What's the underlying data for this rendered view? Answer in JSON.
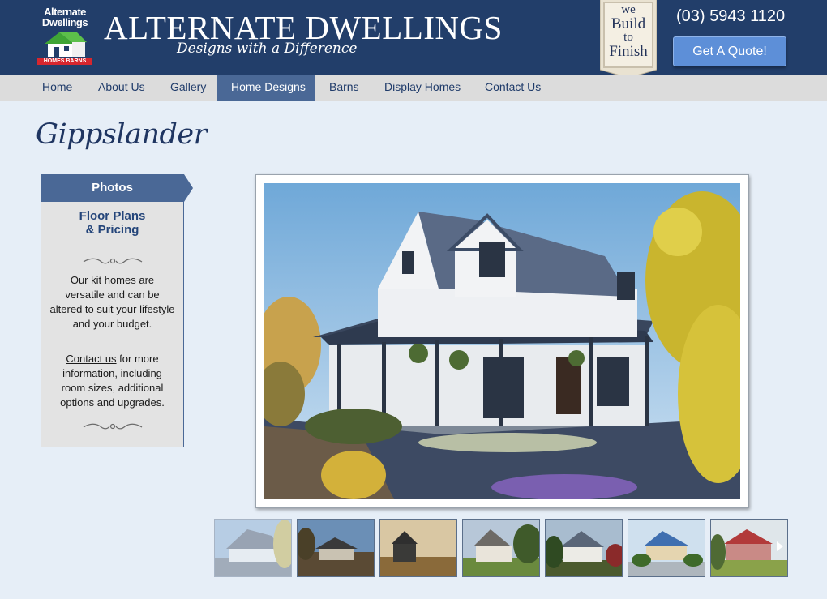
{
  "header": {
    "logo": {
      "line1": "Alternate",
      "line2": "Dwellings",
      "sub": "HOMES BARNS"
    },
    "brand_name": "ALTERNATE DWELLINGS",
    "tagline": "Designs with a Difference",
    "badge": {
      "line1": "we",
      "line2": "Build",
      "line3": "to",
      "line4": "Finish"
    },
    "phone": "(03) 5943 1120",
    "quote_button": "Get A Quote!"
  },
  "nav": {
    "items": [
      {
        "label": "Home"
      },
      {
        "label": "About Us"
      },
      {
        "label": "Gallery"
      },
      {
        "label": "Home Designs"
      },
      {
        "label": "Barns"
      },
      {
        "label": "Display Homes"
      },
      {
        "label": "Contact Us"
      }
    ],
    "active": "Home Designs"
  },
  "page": {
    "title": "Gippslander"
  },
  "sidebar": {
    "tab_label": "Photos",
    "floor_plans_line1": "Floor Plans",
    "floor_plans_line2": "& Pricing",
    "paragraph1": "Our kit homes are versatile and can be altered to suit your lifestyle and your budget.",
    "contact_link": "Contact us",
    "paragraph2_rest": " for more information, including room sizes, additional options and upgrades."
  },
  "gallery": {
    "thumbnail_count": 7,
    "selected_index": 0
  },
  "colors": {
    "header_bg": "#223e6a",
    "nav_bg": "#dcdcdc",
    "nav_active": "#4a6896",
    "page_bg": "#e6eef7",
    "button": "#5d8fd8",
    "logo_green": "#3fa535",
    "logo_red": "#d7262e"
  }
}
